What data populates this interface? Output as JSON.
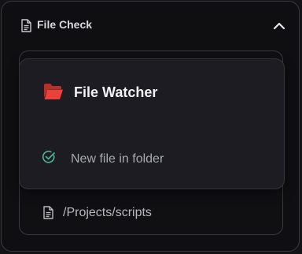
{
  "section": {
    "title": "File Check",
    "header_icon": "document-icon",
    "collapse_icon": "chevron-up-icon"
  },
  "card": {
    "title": "File Watcher",
    "title_icon": "folder-open-icon",
    "trigger": {
      "icon": "check-circle-icon",
      "label": "New file in folder"
    }
  },
  "path": {
    "icon": "document-icon",
    "value": "/Projects/scripts"
  },
  "colors": {
    "background": "#0f0f11",
    "card": "#1c1c22",
    "accent_folder": "#e8423a",
    "accent_check": "#4fb59a"
  }
}
